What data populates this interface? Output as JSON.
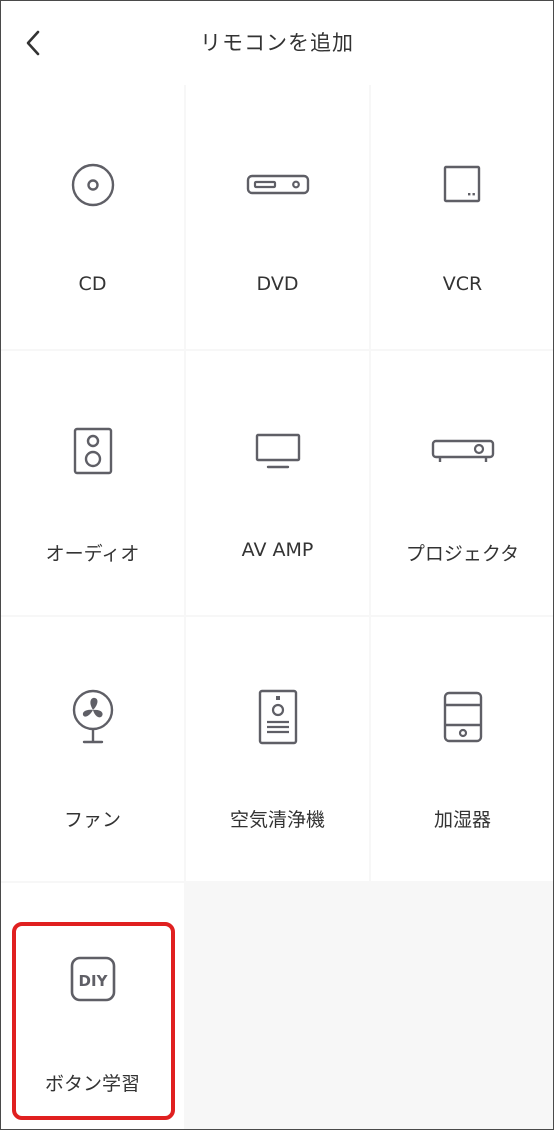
{
  "header": {
    "title": "リモコンを追加",
    "back_icon": "chevron-left-icon"
  },
  "devices": [
    {
      "label": "CD",
      "icon": "cd-disc-icon"
    },
    {
      "label": "DVD",
      "icon": "dvd-player-icon"
    },
    {
      "label": "VCR",
      "icon": "vcr-icon"
    },
    {
      "label": "オーディオ",
      "icon": "speaker-icon"
    },
    {
      "label": "AV AMP",
      "icon": "tv-monitor-icon"
    },
    {
      "label": "プロジェクタ",
      "icon": "projector-icon"
    },
    {
      "label": "ファン",
      "icon": "fan-icon"
    },
    {
      "label": "空気清浄機",
      "icon": "air-purifier-icon"
    },
    {
      "label": "加湿器",
      "icon": "humidifier-icon"
    },
    {
      "label": "ボタン学習",
      "icon": "diy-icon",
      "icon_text": "DIY"
    }
  ],
  "colors": {
    "icon_stroke": "#5f5f66",
    "highlight": "#e02020",
    "grid_bg": "#f7f7f7"
  }
}
